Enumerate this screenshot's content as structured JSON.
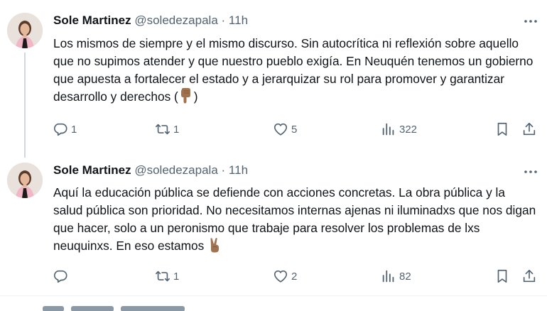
{
  "tweets": [
    {
      "name": "Sole Martinez",
      "handle": "@soledezapala",
      "separator": "·",
      "time": "11h",
      "text_before_emoji": "Los mismos de siempre y el mismo discurso. Sin autocrítica ni reflexión sobre aquello que no supimos atender y que nuestro pueblo exigía. En Neuquén tenemos un gobierno que apuesta a fortalecer el estado y a jerarquizar su rol para promover y garantizar desarrollo y derechos (",
      "emoji": "pointing-down",
      "text_after_emoji": ")",
      "replies": "1",
      "reposts": "1",
      "likes": "5",
      "views": "322"
    },
    {
      "name": "Sole Martinez",
      "handle": "@soledezapala",
      "separator": "·",
      "time": "11h",
      "text_before_emoji": "Aquí la educación pública se defiende con acciones concretas.  La obra pública y la salud pública son prioridad.  No necesitamos internas ajenas ni iluminadxs que nos digan que hacer,  solo a un peronismo que trabaje para resolver los problemas de lxs neuquinxs. En eso estamos ",
      "emoji": "victory-hand",
      "text_after_emoji": "",
      "replies": "",
      "reposts": "1",
      "likes": "2",
      "views": "82"
    }
  ],
  "colors": {
    "text": "#0f1419",
    "secondary": "#536471",
    "divider": "#eff3f4",
    "thread_line": "#cfd9de",
    "emoji_skin": "#a0724e"
  }
}
